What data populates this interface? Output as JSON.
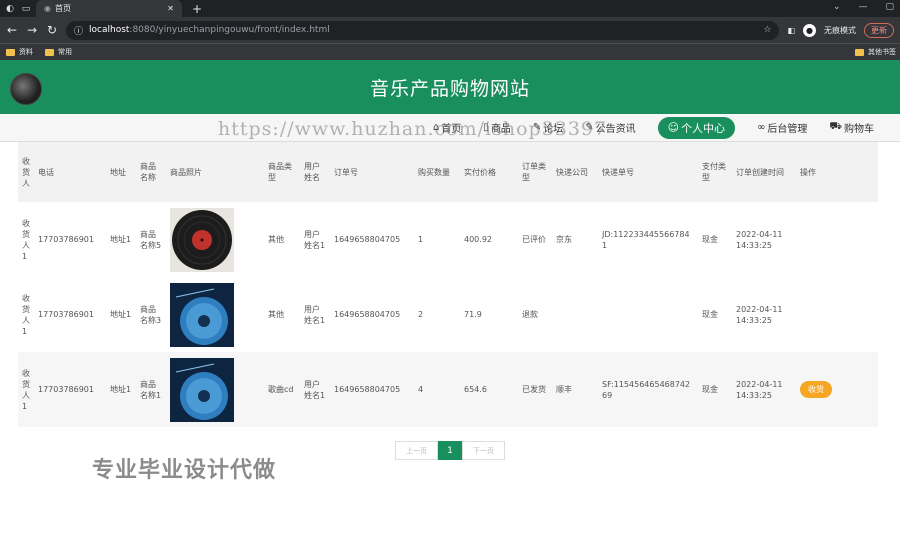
{
  "browser": {
    "tab_title": "首页",
    "new_tab": "+",
    "url_host": "localhost",
    "url_path": ":8080/yinyuechanpingouwu/front/index.html",
    "incognito_label": "无痕模式",
    "update_label": "更新",
    "bookmarks": [
      "资料",
      "常用"
    ],
    "other_bookmarks": "其他书签"
  },
  "site": {
    "title": "音乐产品购物网站"
  },
  "nav": {
    "items": [
      {
        "label": "首页",
        "icon": "home-icon"
      },
      {
        "label": "商品",
        "icon": "grid-icon"
      },
      {
        "label": "论坛",
        "icon": "chat-icon"
      },
      {
        "label": "公告资讯",
        "icon": "news-icon"
      },
      {
        "label": "个人中心",
        "icon": "user-icon",
        "active": true
      },
      {
        "label": "后台管理",
        "icon": "link-icon"
      },
      {
        "label": "购物车",
        "icon": "cart-icon"
      }
    ]
  },
  "watermark": "https://www.huzhan.com/ishop33397",
  "table": {
    "headers": [
      "收货人",
      "电话",
      "地址",
      "商品名称",
      "商品照片",
      "商品类型",
      "用户姓名",
      "订单号",
      "购买数量",
      "实付价格",
      "订单类型",
      "快递公司",
      "快递单号",
      "支付类型",
      "订单创建时间",
      "操作"
    ],
    "rows": [
      {
        "receiver": "收货人1",
        "phone": "17703786901",
        "address": "地址1",
        "product": "商品名称5",
        "ptype": "其他",
        "user": "用户姓名1",
        "order_no": "1649658804705",
        "qty": "1",
        "price": "400.92",
        "status": "已评价",
        "express": "京东",
        "express_no": "JD:1122334455667841",
        "pay": "现金",
        "created": "2022-04-11 14:33:25",
        "action": ""
      },
      {
        "receiver": "收货人1",
        "phone": "17703786901",
        "address": "地址1",
        "product": "商品名称3",
        "ptype": "其他",
        "user": "用户姓名1",
        "order_no": "1649658804705",
        "qty": "2",
        "price": "71.9",
        "status": "退款",
        "express": "",
        "express_no": "",
        "pay": "现金",
        "created": "2022-04-11 14:33:25",
        "action": ""
      },
      {
        "receiver": "收货人1",
        "phone": "17703786901",
        "address": "地址1",
        "product": "商品名称1",
        "ptype": "歌曲cd",
        "user": "用户姓名1",
        "order_no": "1649658804705",
        "qty": "4",
        "price": "654.6",
        "status": "已发货",
        "express": "顺丰",
        "express_no": "SF:11545646546874269",
        "pay": "现金",
        "created": "2022-04-11 14:33:25",
        "action": "收货"
      }
    ]
  },
  "pager": {
    "prev": "上一页",
    "current": "1",
    "next": "下一页"
  },
  "promo": "专业毕业设计代做",
  "colors": {
    "brand": "#1a8f5e",
    "action": "#f5a623"
  }
}
